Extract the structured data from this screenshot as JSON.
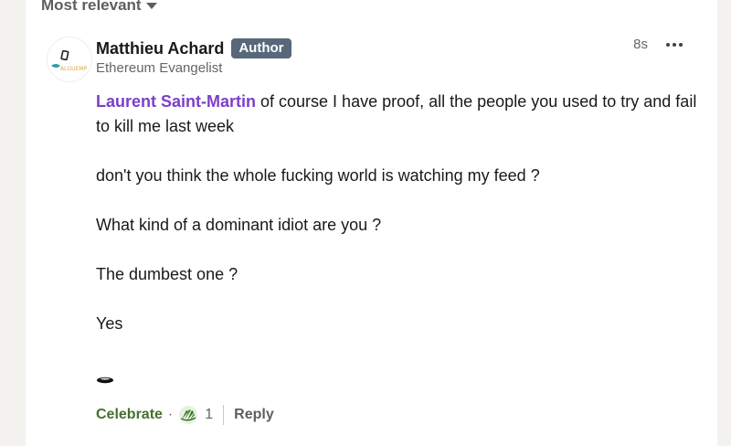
{
  "sort": {
    "label": "Most relevant"
  },
  "comment": {
    "author_name": "Matthieu Achard",
    "author_badge": "Author",
    "headline": "Ethereum Evangelist",
    "timestamp": "8s",
    "mention": "Laurent Saint-Martin",
    "first_line_rest": " of course I have proof, all the people you used to try and fail to kill me last week",
    "paragraphs": [
      "don't you think the whole fucking world is watching my feed ?",
      "What kind of a dominant idiot are you ?",
      "The dumbest one ?",
      "Yes"
    ]
  },
  "actions": {
    "celebrate_label": "Celebrate",
    "separator": "·",
    "reaction_count": "1",
    "reply_label": "Reply"
  },
  "colors": {
    "mention": "#7c3fc7",
    "celebrate": "#44712e",
    "badge_bg": "#56687a"
  },
  "icons": {
    "sort_caret": "caret-down-icon",
    "more": "more-horizontal-icon",
    "reaction": "celebrate-reaction-icon"
  }
}
